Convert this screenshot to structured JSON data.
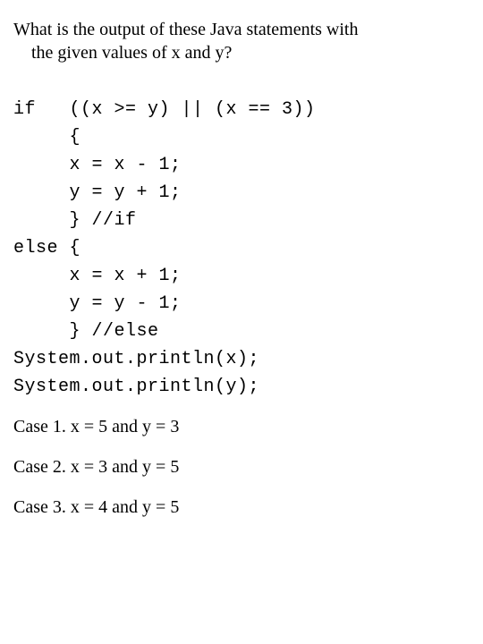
{
  "question": {
    "line1": "What is the output of these Java statements with",
    "line2": "the given values of x and y?"
  },
  "code": {
    "l1": "if   ((x >= y) || (x == 3))",
    "l2": "     {",
    "l3": "     x = x - 1;",
    "l4": "     y = y + 1;",
    "l5": "     } //if",
    "l6": "else {",
    "l7": "     x = x + 1;",
    "l8": "     y = y - 1;",
    "l9": "     } //else",
    "l10": "System.out.println(x);",
    "l11": "System.out.println(y);"
  },
  "cases": {
    "c1": "Case 1. x = 5 and y = 3",
    "c2": "Case 2. x = 3 and y = 5",
    "c3": "Case 3. x = 4 and y = 5"
  }
}
